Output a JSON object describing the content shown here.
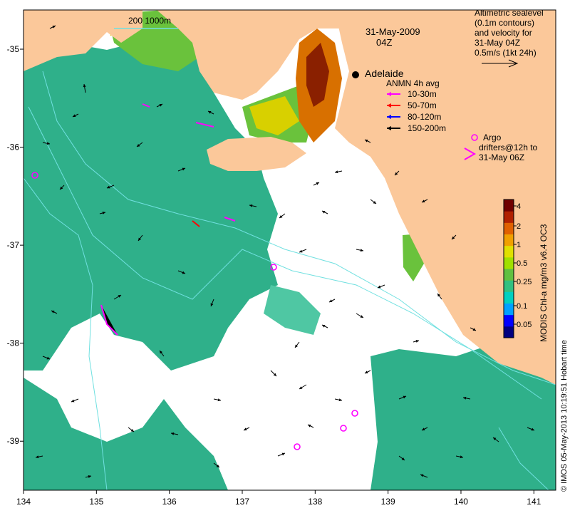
{
  "map": {
    "date_title": "31-May-2009",
    "time_title": "04Z",
    "place_label": "Adelaide",
    "depth_contours_label": "200  1000m",
    "bottom_axis_ticks": [
      "134",
      "135",
      "136",
      "137",
      "138",
      "139",
      "140",
      "141"
    ],
    "left_axis_ticks": [
      "-35",
      "-36",
      "-37",
      "-38",
      "-39"
    ],
    "longitude_range": [
      134,
      141.3
    ],
    "latitude_range": [
      -39.5,
      -34.6
    ],
    "credit": "© IMOS 05-May-2013 10:19:51 Hobart time"
  },
  "altimetry_legend": {
    "lines": [
      "Altimetric sealevel",
      "(0.1m contours)",
      "and velocity for",
      "31-May 04Z",
      "0.5m/s (1kt 24h)"
    ]
  },
  "anmn_legend": {
    "title": "ANMN 4h avg",
    "items": [
      {
        "label": "10-30m",
        "color": "#ff00ff"
      },
      {
        "label": "50-70m",
        "color": "#ff0000"
      },
      {
        "label": "80-120m",
        "color": "#0000ff"
      },
      {
        "label": "150-200m",
        "color": "#000000"
      }
    ]
  },
  "argo_legend": {
    "line1": "Argo",
    "line2": "drifters@12h to",
    "line3": "31-May 06Z",
    "color": "#ff00ff"
  },
  "colorbar": {
    "title": "MODIS Chl-a mg/m3 v6.4 OC3",
    "ticks": [
      "4",
      "2",
      "1",
      "0.5",
      "0.25",
      "0.1",
      "0.05"
    ],
    "colors": [
      "#000080",
      "#0000ff",
      "#00a0ff",
      "#00d0c0",
      "#30c080",
      "#60c040",
      "#a0e000",
      "#e0e000",
      "#f0a000",
      "#e06000",
      "#b02000",
      "#700000"
    ]
  },
  "colors": {
    "land": "#fbc89a",
    "ocean": "#ffffff",
    "chl_main": "#2fb08a",
    "chl_light": "#4fc7a3",
    "chl_green": "#6ac23c",
    "chl_yellow": "#d8d000",
    "chl_orange": "#d87000",
    "chl_brown": "#8a2000",
    "contour": "#70e0e0",
    "argo": "#ff00ff"
  }
}
